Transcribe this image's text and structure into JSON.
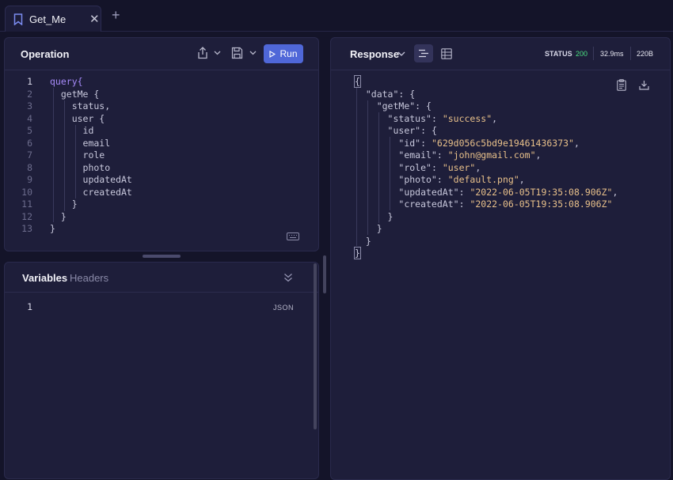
{
  "tab": {
    "title": "Get_Me",
    "close": "✕",
    "new": "+"
  },
  "operation": {
    "title": "Operation",
    "run_label": "Run",
    "lines": [
      {
        "n": "1",
        "text": "query{"
      },
      {
        "n": "2",
        "text": "  getMe {"
      },
      {
        "n": "3",
        "text": "    status,"
      },
      {
        "n": "4",
        "text": "    user {"
      },
      {
        "n": "5",
        "text": "      id"
      },
      {
        "n": "6",
        "text": "      email"
      },
      {
        "n": "7",
        "text": "      role"
      },
      {
        "n": "8",
        "text": "      photo"
      },
      {
        "n": "9",
        "text": "      updatedAt"
      },
      {
        "n": "10",
        "text": "      createdAt"
      },
      {
        "n": "11",
        "text": "    }"
      },
      {
        "n": "12",
        "text": "  }"
      },
      {
        "n": "13",
        "text": "}"
      }
    ]
  },
  "variables": {
    "tab_variables": "Variables",
    "tab_headers": "Headers",
    "line_number": "1",
    "format_label": "JSON"
  },
  "response": {
    "title": "Response",
    "status_label": "STATUS",
    "status_code": "200",
    "time": "32.9ms",
    "size": "220B",
    "lines": [
      "{",
      "  \"data\": {",
      "    \"getMe\": {",
      "      \"status\": \"success\",",
      "      \"user\": {",
      "        \"id\": \"629d056c5bd9e19461436373\",",
      "        \"email\": \"john@gmail.com\",",
      "        \"role\": \"user\",",
      "        \"photo\": \"default.png\",",
      "        \"updatedAt\": \"2022-06-05T19:35:08.906Z\",",
      "        \"createdAt\": \"2022-06-05T19:35:08.906Z\"",
      "      }",
      "    }",
      "  }",
      "}"
    ]
  },
  "colors": {
    "accent": "#4f67d8",
    "status_ok": "#4ade80",
    "string": "#e8c08a",
    "keyword": "#a78bfa"
  }
}
